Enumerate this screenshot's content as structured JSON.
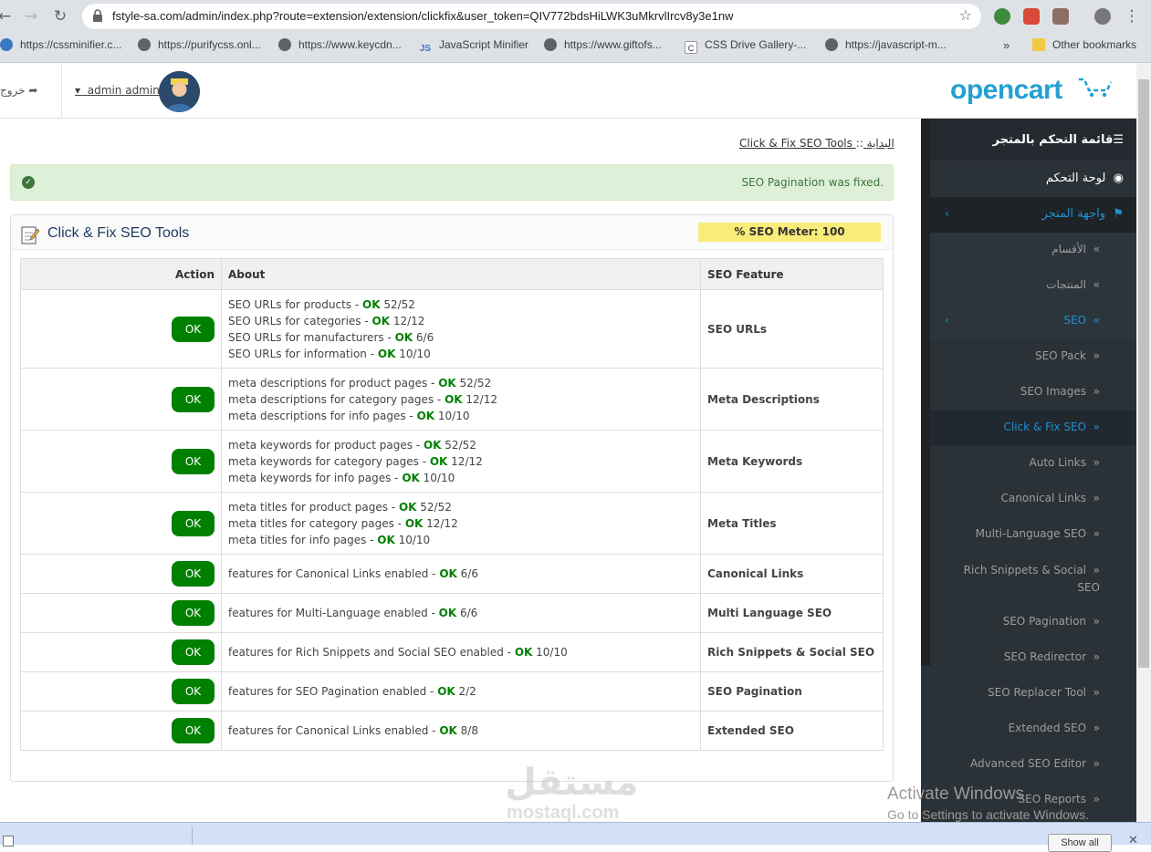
{
  "browser": {
    "url": "fstyle-sa.com/admin/index.php?route=extension/extension/clickfix&user_token=QIV772bdsHiLWK3uMkrvlIrcv8y3e1nw",
    "bookmarks": [
      "https://cssminifier.c...",
      "https://purifycss.onl...",
      "https://www.keycdn...",
      "JavaScript Minifier",
      "https://www.giftofs...",
      "CSS Drive Gallery-...",
      "https://javascript-m..."
    ],
    "other_bookmarks": "Other bookmarks",
    "more": "»"
  },
  "header": {
    "logout": "خروج",
    "user_name": "admin admin",
    "logo_text": "opencart"
  },
  "sidebar": {
    "title": "قائمة التحكم بالمتجر",
    "dashboard": "لوحة التحكم",
    "store": "واجهة المتجر",
    "items": [
      {
        "label": "الأقسام"
      },
      {
        "label": "المنتجات"
      },
      {
        "label": "SEO"
      },
      {
        "label": "SEO Pack"
      },
      {
        "label": "SEO Images"
      },
      {
        "label": "Click & Fix SEO"
      },
      {
        "label": "Auto Links"
      },
      {
        "label": "Canonical Links"
      },
      {
        "label": "Multi-Language SEO"
      },
      {
        "label": "Rich Snippets & Social SEO"
      },
      {
        "label": "SEO Pagination"
      },
      {
        "label": "SEO Redirector"
      },
      {
        "label": "SEO Replacer Tool"
      },
      {
        "label": "Extended SEO"
      },
      {
        "label": "Advanced SEO Editor"
      },
      {
        "label": "SEO Reports"
      }
    ]
  },
  "breadcrumb": {
    "home": "البداية",
    "sep": "::",
    "current": "Click & Fix SEO Tools"
  },
  "alert": {
    "text": "SEO Pagination was fixed."
  },
  "panel": {
    "title": "Click & Fix SEO Tools",
    "meter": "% SEO Meter: 100"
  },
  "table": {
    "headers": {
      "action": "Action",
      "about": "About",
      "feature": "SEO Feature"
    },
    "ok_label": "OK",
    "rows": [
      {
        "feature": "SEO URLs",
        "lines": [
          {
            "pre": "SEO URLs for products - ",
            "ok": "OK",
            "post": " 52/52"
          },
          {
            "pre": "SEO URLs for categories - ",
            "ok": "OK",
            "post": " 12/12"
          },
          {
            "pre": "SEO URLs for manufacturers - ",
            "ok": "OK",
            "post": " 6/6"
          },
          {
            "pre": "SEO URLs for information - ",
            "ok": "OK",
            "post": " 10/10"
          }
        ]
      },
      {
        "feature": "Meta Descriptions",
        "lines": [
          {
            "pre": "meta descriptions for product pages - ",
            "ok": "OK",
            "post": " 52/52"
          },
          {
            "pre": "meta descriptions for category pages - ",
            "ok": "OK",
            "post": " 12/12"
          },
          {
            "pre": "meta descriptions for info pages - ",
            "ok": "OK",
            "post": " 10/10"
          }
        ]
      },
      {
        "feature": "Meta Keywords",
        "lines": [
          {
            "pre": "meta keywords for product pages - ",
            "ok": "OK",
            "post": " 52/52"
          },
          {
            "pre": "meta keywords for category pages - ",
            "ok": "OK",
            "post": " 12/12"
          },
          {
            "pre": "meta keywords for info pages - ",
            "ok": "OK",
            "post": " 10/10"
          }
        ]
      },
      {
        "feature": "Meta Titles",
        "lines": [
          {
            "pre": "meta titles for product pages - ",
            "ok": "OK",
            "post": " 52/52"
          },
          {
            "pre": "meta titles for category pages - ",
            "ok": "OK",
            "post": " 12/12"
          },
          {
            "pre": "meta titles for info pages - ",
            "ok": "OK",
            "post": " 10/10"
          }
        ]
      },
      {
        "feature": "Canonical Links",
        "lines": [
          {
            "pre": "features for Canonical Links enabled - ",
            "ok": "OK",
            "post": " 6/6"
          }
        ]
      },
      {
        "feature": "Multi Language SEO",
        "lines": [
          {
            "pre": "features for Multi-Language enabled - ",
            "ok": "OK",
            "post": " 6/6"
          }
        ]
      },
      {
        "feature": "Rich Snippets & Social SEO",
        "lines": [
          {
            "pre": "features for Rich Snippets and Social SEO enabled - ",
            "ok": "OK",
            "post": " 10/10"
          }
        ]
      },
      {
        "feature": "SEO Pagination",
        "lines": [
          {
            "pre": "features for SEO Pagination enabled - ",
            "ok": "OK",
            "post": " 2/2"
          }
        ]
      },
      {
        "feature": "Extended SEO",
        "lines": [
          {
            "pre": "features for Canonical Links enabled - ",
            "ok": "OK",
            "post": " 8/8"
          }
        ]
      }
    ]
  },
  "overlay": {
    "activate_title": "Activate Windows",
    "activate_sub": "Go to Settings to activate Windows.",
    "watermark_ar": "مستقل",
    "watermark_en": "mostaql.com"
  },
  "downloads": {
    "show_all": "Show all"
  }
}
